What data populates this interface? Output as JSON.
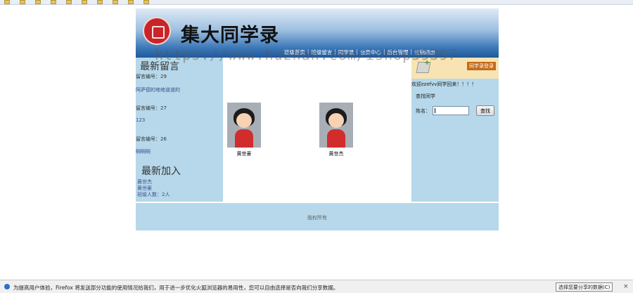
{
  "bookmarks": [
    "",
    "",
    "",
    "",
    "",
    "",
    "",
    "",
    "",
    "",
    "",
    "",
    "",
    "",
    ""
  ],
  "site": {
    "title": "集大同学录",
    "nav": [
      "班级首页",
      "班级留言",
      "同学录",
      "会员中心",
      "后台管理",
      "注销退出"
    ],
    "nav_sep": "|"
  },
  "left": {
    "latest_messages_title": "最新留言",
    "messages": [
      {
        "label": "留言编号：29",
        "text": "阿萨德的地地道道的"
      },
      {
        "label": "留言编号：27",
        "text": "123"
      },
      {
        "label": "留言编号：26",
        "text": "啊啊啊"
      }
    ],
    "latest_join_title": "最新加入",
    "latest_join": [
      "黄世杰",
      "黄世豪",
      "班级人数：2人"
    ]
  },
  "center": {
    "students": [
      {
        "name": "黄世豪"
      },
      {
        "name": "黄世杰"
      }
    ]
  },
  "right": {
    "login_label": "同学录登录",
    "welcome": "欢迎zzefvv同学回来！！！！",
    "find_title": "查找同学",
    "name_label": "姓名：",
    "name_value": "",
    "search_button": "查找"
  },
  "footer": {
    "text": "版权所有"
  },
  "watermark": "https://www.huzhan.com/ishop39397",
  "notification": {
    "text": "为提高用户体验，Firefox 将发送部分功能的使用情况给我们，用于进一步优化火狐浏览器的易用性，您可以自由选择是否向我们分享数据。",
    "button": "选择您要分享的数据(C)",
    "close": "×"
  },
  "colors": {
    "panel": "#b6d8ea",
    "banner_dark": "#1f5a9c",
    "accent_orange": "#c46a18"
  }
}
